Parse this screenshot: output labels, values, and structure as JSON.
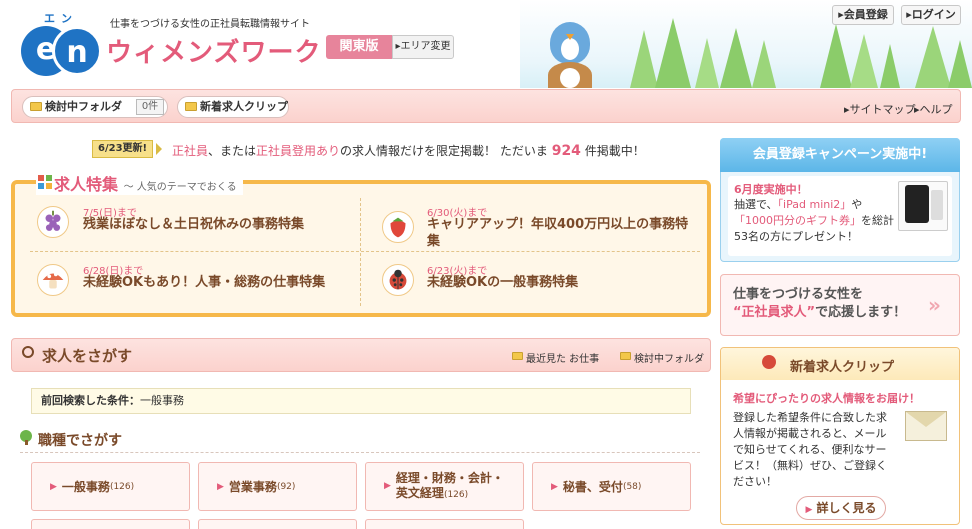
{
  "header": {
    "logo_ruby": "エン",
    "logo_letters": [
      "e",
      "n"
    ],
    "tagline": "仕事をつづける女性の正社員転職情報サイト",
    "site_name": "ウィメンズワーク",
    "region": "関東版",
    "area_change": "エリア変更",
    "register_button": "会員登録",
    "login_button": "ログイン"
  },
  "nav": {
    "saved_folder": "検討中フォルダ",
    "saved_count": "0件",
    "new_clip": "新着求人クリップ",
    "sitemap": "サイトマップ",
    "help": "ヘルプ"
  },
  "intro": {
    "badge": "6/23更新!",
    "part1": "正社員",
    "part2": "、または",
    "part3": "正社員登用あり",
    "part4": "の求人情報だけを限定掲載！ ただいま",
    "count": "924",
    "part5": "件掲載中！"
  },
  "feature": {
    "title": "求人特集",
    "subtitle": "〜 人気のテーマでおくる",
    "items": [
      {
        "date": "7/5(日)まで",
        "text": "残業ほぼなし＆土日祝休みの事務特集",
        "icon": "grape-icon"
      },
      {
        "date": "6/30(火)まで",
        "text": "キャリアアップ！年収400万円以上の事務特集",
        "icon": "strawberry-icon"
      },
      {
        "date": "6/28(日)まで",
        "text": "未経験OKもあり！人事・総務の仕事特集",
        "icon": "mushroom-icon"
      },
      {
        "date": "6/23(火)まで",
        "text": "未経験OKの一般事務特集",
        "icon": "ladybug-icon"
      }
    ]
  },
  "search": {
    "title": "求人をさがす",
    "recent_link": "最近見た お仕事",
    "folder_link": "検討中フォルダ",
    "prev_label": "前回検索した条件：",
    "prev_value": "一般事務",
    "job_type_title": "職種でさがす",
    "categories": [
      {
        "name": "一般事務",
        "count": "(126)"
      },
      {
        "name": "営業事務",
        "count": "(92)"
      },
      {
        "name": "経理・財務・会計・",
        "name2": "英文経理",
        "count": "(126)"
      },
      {
        "name": "秘書、受付",
        "count": "(58)"
      }
    ]
  },
  "sidebar": {
    "campaign_title": "会員登録キャンペーン実施中!",
    "campaign_month": "6月度実施中！",
    "campaign_text_a": "抽選で、",
    "campaign_hl1": "「iPad mini2」",
    "campaign_text_b": "や",
    "campaign_hl2": "「1000円分のギフト券」",
    "campaign_text_c": "を総計53名の方にプレゼント！",
    "promo_line1": "仕事をつづける女性を",
    "promo_quote": "“正社員求人”",
    "promo_line2": "で応援します！",
    "clip_title": "新着求人クリップ",
    "clip_sub": "希望にぴったりの求人情報をお届け！",
    "clip_text": "登録した希望条件に合致した求人情報が掲載されると、メールで知らせてくれる、便利なサービス！（無料）ぜひ、ご登録ください！",
    "clip_button": "詳しく見る"
  },
  "colors": {
    "brand_pink": "#e35b7a",
    "brand_blue": "#1f73c4",
    "feature_border": "#f6b84a",
    "nav_bg": "#fbd2cd",
    "campaign_blue": "#5cb6e8"
  }
}
